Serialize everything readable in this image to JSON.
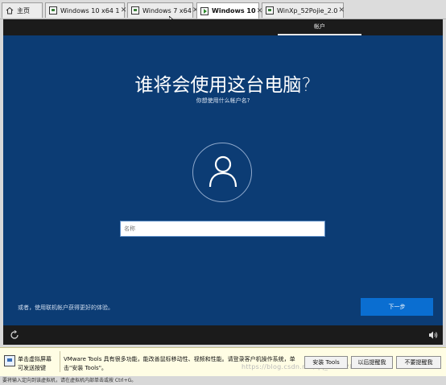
{
  "tabs": [
    {
      "label": "主页",
      "icon": "home-icon",
      "active": false
    },
    {
      "label": "Windows 10 x64 1",
      "icon": "vm-icon",
      "active": false
    },
    {
      "label": "Windows 7 x64",
      "icon": "vm-icon",
      "active": false
    },
    {
      "label": "Windows 10",
      "icon": "vm-running-icon",
      "active": true
    },
    {
      "label": "WinXp_52Pojie_2.0",
      "icon": "vm-icon",
      "active": false
    }
  ],
  "oobe": {
    "account_tab": "帐户",
    "title": "谁将会使用这台电脑?",
    "subtitle": "你想使用什么帐户名?",
    "name_placeholder": "名称",
    "name_value": "",
    "online_account_link": "或者，使用联机帐户获得更好的体验。",
    "next_button": "下一步"
  },
  "notification": {
    "click_hint": "单击虚拟屏幕\n可发送按键",
    "message": "VMware Tools 具有很多功能，能改善鼠标移动性、视频和性能。请登录客户机操作系统，单击\"安装 Tools\"。",
    "install_button": "安装 Tools",
    "remind_later_button": "以后提醒我",
    "dont_remind_button": "不要提醒我",
    "watermark": "https://blog.csdn.net/qq_40722819"
  },
  "status_bar": "要将输入定向到该虚拟机，请在虚拟机内部单击或按 Ctrl+G。",
  "colors": {
    "oobe_background": "#0c3c74",
    "next_button": "#0a6ed1",
    "notification_background": "#fffde4"
  }
}
